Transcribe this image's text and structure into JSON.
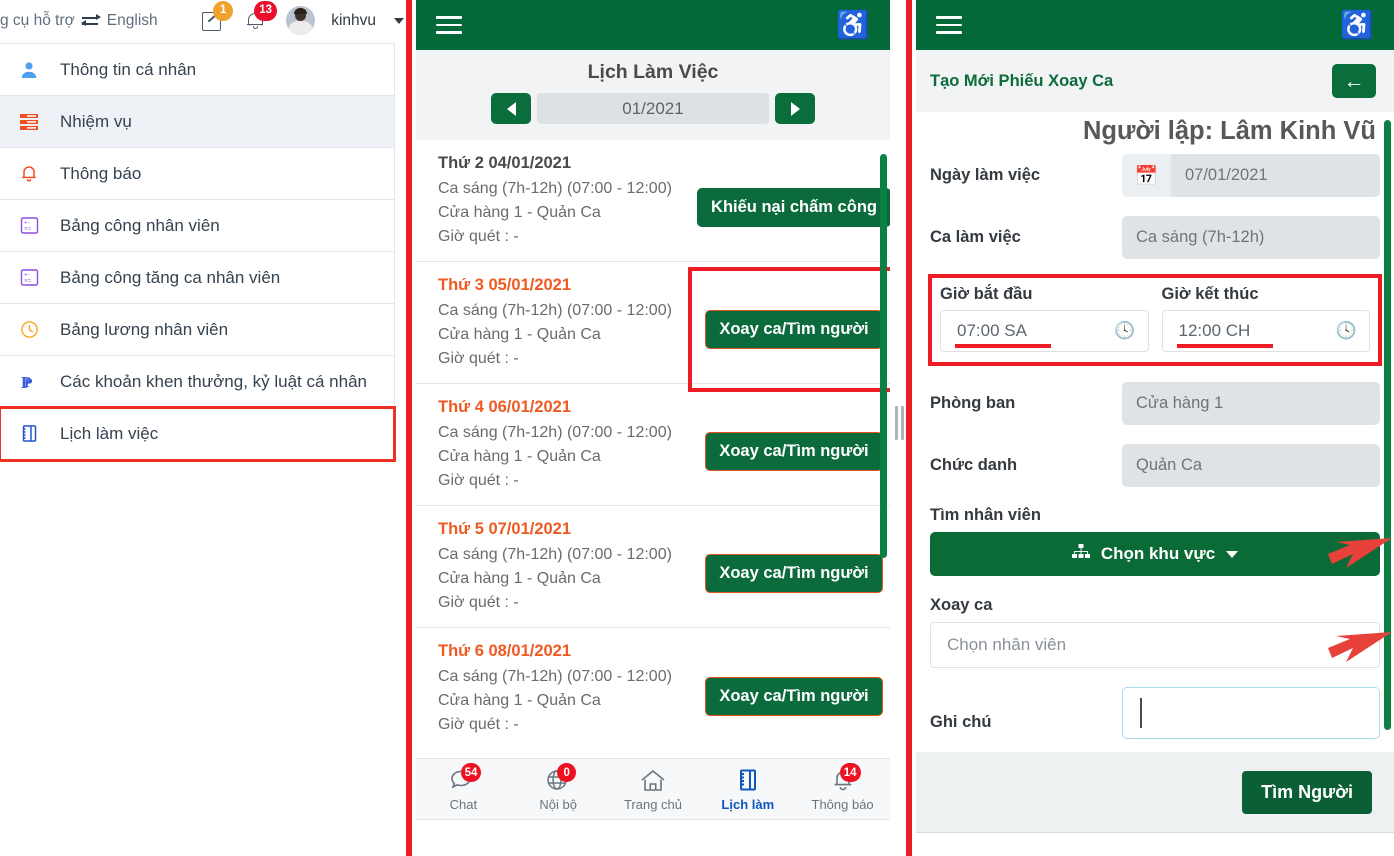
{
  "topbar": {
    "support_text": "g cụ hỗ trợ",
    "language": "English",
    "edit_badge": "1",
    "bell_badge": "13",
    "username": "kinhvu"
  },
  "sidebar": {
    "items": [
      {
        "label": "Thông tin cá nhân",
        "icon": "user-icon"
      },
      {
        "label": "Nhiệm vụ",
        "icon": "tasks-icon"
      },
      {
        "label": "Thông báo",
        "icon": "bell-icon"
      },
      {
        "label": "Bảng công nhân viên",
        "icon": "timesheet-icon"
      },
      {
        "label": "Bảng công tăng ca nhân viên",
        "icon": "overtime-icon"
      },
      {
        "label": "Bảng lương nhân viên",
        "icon": "clock-icon"
      },
      {
        "label": "Các khoản khen thưởng, kỷ luật cá nhân",
        "icon": "paypal-icon"
      },
      {
        "label": "Lịch làm việc",
        "icon": "notebook-icon"
      }
    ]
  },
  "middle": {
    "title": "Lịch Làm Việc",
    "month": "01/2021",
    "prev_label": "◀",
    "next_label": "▶",
    "rows": [
      {
        "date": "Thứ 2 04/01/2021",
        "shift": "Ca sáng (7h-12h) (07:00 - 12:00)",
        "place": "Cửa hàng 1 - Quản Ca",
        "scan": "Giờ quét : -",
        "button": "Khiếu nại chấm công"
      },
      {
        "date": "Thứ 3 05/01/2021",
        "shift": "Ca sáng (7h-12h) (07:00 - 12:00)",
        "place": "Cửa hàng 1 - Quản Ca",
        "scan": "Giờ quét : -",
        "button": "Xoay ca/Tìm người"
      },
      {
        "date": "Thứ 4 06/01/2021",
        "shift": "Ca sáng (7h-12h) (07:00 - 12:00)",
        "place": "Cửa hàng 1 - Quản Ca",
        "scan": "Giờ quét : -",
        "button": "Xoay ca/Tìm người"
      },
      {
        "date": "Thứ 5 07/01/2021",
        "shift": "Ca sáng (7h-12h) (07:00 - 12:00)",
        "place": "Cửa hàng 1 - Quản Ca",
        "scan": "Giờ quét : -",
        "button": "Xoay ca/Tìm người"
      },
      {
        "date": "Thứ 6 08/01/2021",
        "shift": "Ca sáng (7h-12h) (07:00 - 12:00)",
        "place": "Cửa hàng 1 - Quản Ca",
        "scan": "Giờ quét : -",
        "button": "Xoay ca/Tìm người"
      }
    ],
    "bottom_nav": [
      {
        "label": "Chat",
        "badge": "54",
        "icon": "chat-icon"
      },
      {
        "label": "Nội bộ",
        "badge": "0",
        "icon": "globe-icon"
      },
      {
        "label": "Trang chủ",
        "badge": "",
        "icon": "home-icon"
      },
      {
        "label": "Lịch làm",
        "badge": "",
        "icon": "notebook-icon"
      },
      {
        "label": "Thông báo",
        "badge": "14",
        "icon": "bell-icon"
      }
    ]
  },
  "right": {
    "subtitle": "Tạo Mới Phiếu Xoay Ca",
    "back_label": "←",
    "creator": "Người lập: Lâm Kinh Vũ",
    "fields": {
      "date_label": "Ngày làm việc",
      "date_value": "07/01/2021",
      "shift_label": "Ca làm việc",
      "shift_value": "Ca sáng (7h-12h)",
      "start_label": "Giờ bắt đầu",
      "start_value": "07:00 SA",
      "end_label": "Giờ kết thúc",
      "end_value": "12:00 CH",
      "dept_label": "Phòng ban",
      "dept_value": "Cửa hàng 1",
      "role_label": "Chức danh",
      "role_value": "Quản Ca",
      "find_emp_label": "Tìm nhân viên",
      "area_select": "Chọn khu vực",
      "rotate_label": "Xoay ca",
      "employee_placeholder": "Chọn nhân viên",
      "note_label": "Ghi chú",
      "note_value": ""
    },
    "submit_label": "Tìm Người"
  },
  "colors": {
    "brand_green": "#046938",
    "accent_red": "#ee1c25",
    "highlight_orange": "#ef5a22",
    "link_blue": "#1155bb"
  }
}
